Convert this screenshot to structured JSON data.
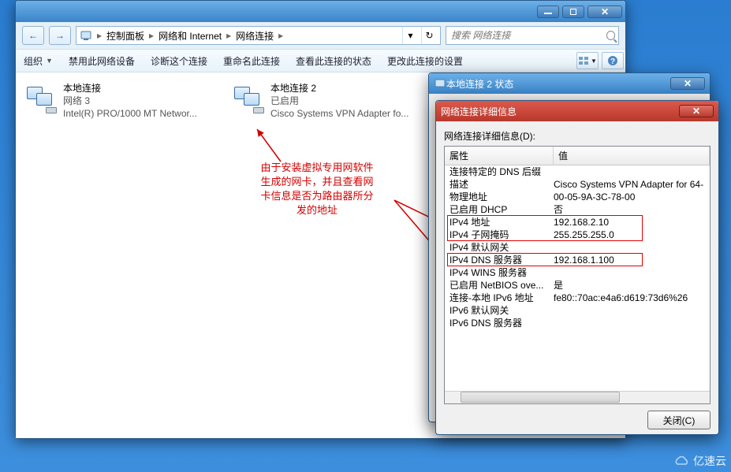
{
  "main_window": {
    "breadcrumb": [
      "控制面板",
      "网络和 Internet",
      "网络连接"
    ],
    "search_placeholder": "搜索 网络连接",
    "toolbar": {
      "organize": "组织",
      "disable": "禁用此网络设备",
      "diagnose": "诊断这个连接",
      "rename": "重命名此连接",
      "view_status": "查看此连接的状态",
      "change_settings": "更改此连接的设置"
    },
    "connections": [
      {
        "name": "本地连接",
        "line2": "网络  3",
        "line3": "Intel(R) PRO/1000 MT Networ..."
      },
      {
        "name": "本地连接 2",
        "line2": "已启用",
        "line3": "Cisco Systems VPN Adapter fo..."
      }
    ]
  },
  "annotation": "由于安装虚拟专用网软件\n生成的网卡，并且查看网\n卡信息是否为路由器所分\n发的地址",
  "status_popup": {
    "title": "本地连接 2 状态"
  },
  "details_popup": {
    "title": "网络连接详细信息",
    "heading": "网络连接详细信息(D):",
    "col_property": "属性",
    "col_value": "值",
    "rows": [
      {
        "p": "连接特定的 DNS 后缀",
        "v": ""
      },
      {
        "p": "描述",
        "v": "Cisco Systems VPN Adapter for 64-"
      },
      {
        "p": "物理地址",
        "v": "00-05-9A-3C-78-00"
      },
      {
        "p": "已启用 DHCP",
        "v": "否"
      },
      {
        "p": "IPv4 地址",
        "v": "192.168.2.10"
      },
      {
        "p": "IPv4 子网掩码",
        "v": "255.255.255.0"
      },
      {
        "p": "IPv4 默认网关",
        "v": ""
      },
      {
        "p": "IPv4 DNS 服务器",
        "v": "192.168.1.100"
      },
      {
        "p": "IPv4 WINS 服务器",
        "v": ""
      },
      {
        "p": "已启用 NetBIOS ove...",
        "v": "是"
      },
      {
        "p": "连接-本地 IPv6 地址",
        "v": "fe80::70ac:e4a6:d619:73d6%26"
      },
      {
        "p": "IPv6 默认网关",
        "v": ""
      },
      {
        "p": "IPv6 DNS 服务器",
        "v": ""
      }
    ],
    "close_btn": "关闭(C)"
  },
  "watermark": "亿速云"
}
